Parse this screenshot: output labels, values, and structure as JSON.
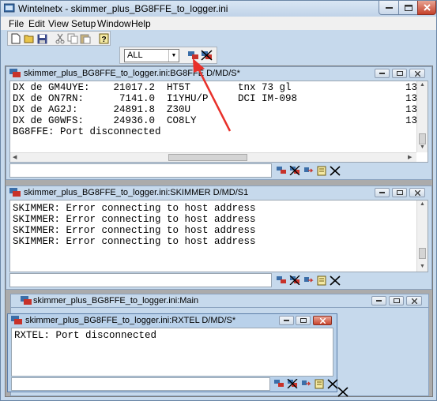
{
  "app": {
    "title": "Wintelnetx - skimmer_plus_BG8FFE_to_logger.ini"
  },
  "menu": [
    "File",
    "Edit",
    "View",
    "Setup",
    "Window",
    "Help"
  ],
  "filter": {
    "selected": "ALL"
  },
  "windows": {
    "rbn": {
      "title": "skimmer_plus_BG8FFE_to_logger.ini:BG8FFE D/MD/S*",
      "lines": [
        "DX de GM4UYE:    21017.2  HT5T        tnx 73 gl",
        "DX de ON7RN:      7141.0  I1YHU/P     DCI IM-098",
        "DX de AG2J:      24891.8  Z30U",
        "DX de G0WFS:     24936.0  CO8LY",
        "BG8FFE: Port disconnected"
      ],
      "right_col": [
        "13",
        "13",
        "13",
        "13"
      ]
    },
    "skimmer": {
      "title": "skimmer_plus_BG8FFE_to_logger.ini:SKIMMER D/MD/S1",
      "lines": [
        "SKIMMER: Error connecting to host address",
        "SKIMMER: Error connecting to host address",
        "SKIMMER: Error connecting to host address",
        "SKIMMER: Error connecting to host address"
      ]
    },
    "main": {
      "title": "skimmer_plus_BG8FFE_to_logger.ini:Main"
    },
    "rxtel": {
      "title": "skimmer_plus_BG8FFE_to_logger.ini:RXTEL D/MD/S*",
      "lines": [
        "RXTEL: Port disconnected"
      ]
    }
  },
  "colors": {
    "annotation_arrow": "#e8302a",
    "frame": "#c6d9ec"
  }
}
